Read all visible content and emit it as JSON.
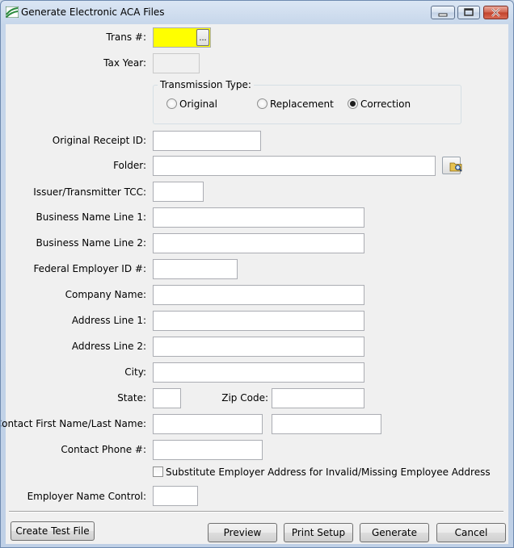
{
  "window": {
    "title": "Generate Electronic ACA Files",
    "icons": [
      "app-icon",
      "minimize-icon",
      "maximize-icon",
      "close-icon"
    ]
  },
  "form": {
    "trans": {
      "label": "Trans #:",
      "value": "",
      "lookup_label": "..."
    },
    "tax_year": {
      "label": "Tax Year:",
      "value": ""
    },
    "transmission_type": {
      "legend": "Transmission Type:",
      "options": [
        "Original",
        "Replacement",
        "Correction"
      ],
      "selected": "Correction"
    },
    "original_receipt_id": {
      "label": "Original Receipt ID:",
      "value": ""
    },
    "folder": {
      "label": "Folder:",
      "value": "",
      "browse_icon": "folder-search-icon"
    },
    "issuer_tcc": {
      "label": "Issuer/Transmitter TCC:",
      "value": ""
    },
    "business_name_line1": {
      "label": "Business Name Line 1:",
      "value": ""
    },
    "business_name_line2": {
      "label": "Business Name Line 2:",
      "value": ""
    },
    "federal_employer_id": {
      "label": "Federal Employer ID #:",
      "value": ""
    },
    "company_name": {
      "label": "Company Name:",
      "value": ""
    },
    "address_line1": {
      "label": "Address Line 1:",
      "value": ""
    },
    "address_line2": {
      "label": "Address Line 2:",
      "value": ""
    },
    "city": {
      "label": "City:",
      "value": ""
    },
    "state": {
      "label": "State:",
      "value": ""
    },
    "zip_code": {
      "label": "Zip Code:",
      "value": ""
    },
    "contact_name": {
      "label": "Contact First Name/Last Name:",
      "first": "",
      "last": ""
    },
    "contact_phone": {
      "label": "Contact Phone #:",
      "value": ""
    },
    "substitute_address": {
      "label": "Substitute Employer Address for Invalid/Missing Employee Address",
      "checked": false
    },
    "employer_name_control": {
      "label": "Employer Name Control:",
      "value": ""
    }
  },
  "buttons": {
    "create_test_file": "Create Test File",
    "preview": "Preview",
    "print_setup": "Print Setup",
    "generate": "Generate",
    "cancel": "Cancel"
  },
  "colors": {
    "required_field": "#ffff00",
    "client_bg": "#f0f0f0",
    "titlebar": "#c6d6ea"
  }
}
